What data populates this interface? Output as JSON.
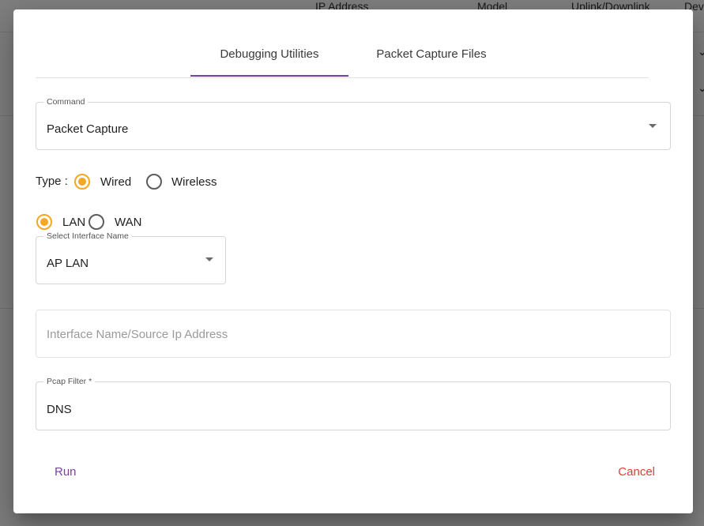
{
  "background": {
    "columns": [
      "IP Address",
      "Model",
      "Uplink/Downlink",
      "Dev"
    ]
  },
  "tabs": [
    {
      "label": "Debugging Utilities",
      "active": true
    },
    {
      "label": "Packet Capture Files",
      "active": false
    }
  ],
  "command": {
    "legend": "Command",
    "value": "Packet Capture"
  },
  "type_selector": {
    "label": "Type :",
    "options": [
      {
        "label": "Wired",
        "selected": true
      },
      {
        "label": "Wireless",
        "selected": false
      }
    ]
  },
  "network_selector": {
    "options": [
      {
        "label": "LAN",
        "selected": true
      },
      {
        "label": "WAN",
        "selected": false
      }
    ]
  },
  "interface": {
    "legend": "Select Interface Name",
    "value": "AP LAN"
  },
  "source": {
    "placeholder": "Interface Name/Source Ip Address",
    "value": ""
  },
  "pcap_filter": {
    "legend": "Pcap Filter *",
    "value": "DNS"
  },
  "actions": {
    "run_label": "Run",
    "cancel_label": "Cancel"
  },
  "colors": {
    "accent": "#7b3fa0",
    "radio": "#f5a623",
    "cancel": "#e53935"
  }
}
